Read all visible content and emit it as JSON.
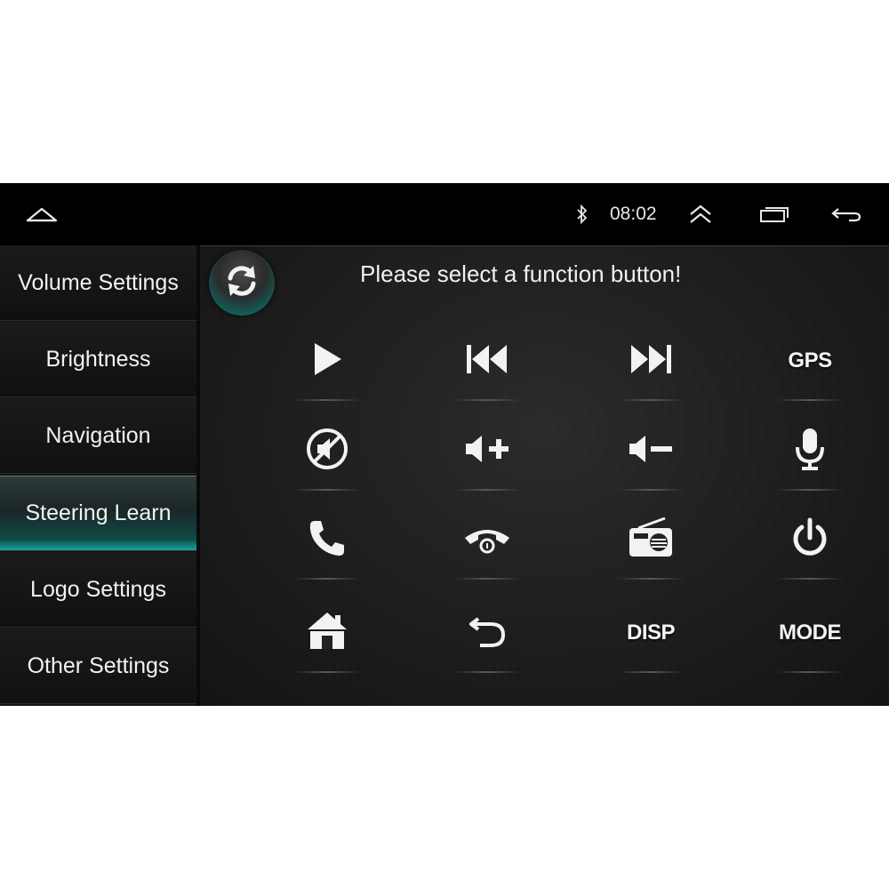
{
  "statusbar": {
    "time": "08:02",
    "icons": [
      "home-icon",
      "bluetooth-icon",
      "expand-up-icon",
      "recent-apps-icon",
      "back-icon"
    ]
  },
  "sidebar": {
    "items": [
      {
        "label": "Volume Settings",
        "active": false
      },
      {
        "label": "Brightness",
        "active": false
      },
      {
        "label": "Navigation",
        "active": false
      },
      {
        "label": "Steering Learn",
        "active": true
      },
      {
        "label": "Logo Settings",
        "active": false
      },
      {
        "label": "Other Settings",
        "active": false
      }
    ]
  },
  "main": {
    "prompt": "Please select a function button!",
    "refresh_icon": "refresh-icon",
    "buttons": [
      {
        "icon": "play-icon"
      },
      {
        "icon": "previous-track-icon"
      },
      {
        "icon": "next-track-icon"
      },
      {
        "label": "GPS"
      },
      {
        "icon": "mute-icon"
      },
      {
        "icon": "volume-up-icon"
      },
      {
        "icon": "volume-down-icon"
      },
      {
        "icon": "microphone-icon"
      },
      {
        "icon": "phone-answer-icon"
      },
      {
        "icon": "phone-hangup-icon"
      },
      {
        "icon": "radio-icon"
      },
      {
        "icon": "power-icon"
      },
      {
        "icon": "home-icon"
      },
      {
        "icon": "back-icon"
      },
      {
        "label": "DISP"
      },
      {
        "label": "MODE"
      }
    ]
  },
  "colors": {
    "accent_teal": "#18c2b0",
    "background": "#000000",
    "text": "#f2f2f2"
  }
}
